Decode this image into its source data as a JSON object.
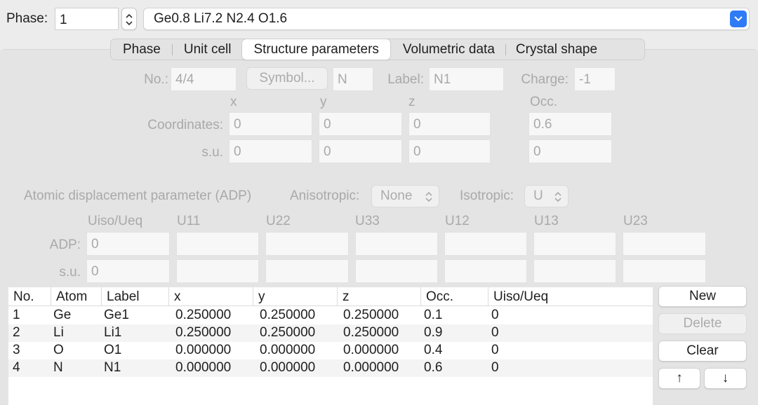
{
  "phase": {
    "label": "Phase:",
    "value": "1",
    "selected_phase": "Ge0.8 Li7.2 N2.4 O1.6"
  },
  "tabs": [
    {
      "label": "Phase",
      "selected": false
    },
    {
      "label": "Unit cell",
      "selected": false
    },
    {
      "label": "Structure parameters",
      "selected": true
    },
    {
      "label": "Volumetric data",
      "selected": false
    },
    {
      "label": "Crystal shape",
      "selected": false
    }
  ],
  "atom_form": {
    "no_label": "No.:",
    "no_value": "4/4",
    "symbol_button": "Symbol...",
    "symbol_value": "N",
    "label_label": "Label:",
    "label_value": "N1",
    "charge_label": "Charge:",
    "charge_value": "-1",
    "col_x": "x",
    "col_y": "y",
    "col_z": "z",
    "col_occ": "Occ.",
    "coordinates_label": "Coordinates:",
    "coord_x": "0",
    "coord_y": "0",
    "coord_z": "0",
    "occ_value": "0.6",
    "su_label": "s.u.",
    "su_x": "0",
    "su_y": "0",
    "su_z": "0",
    "su_occ": "0"
  },
  "adp": {
    "section_label": "Atomic displacement parameter (ADP)",
    "anisotropic_label": "Anisotropic:",
    "anisotropic_value": "None",
    "isotropic_label": "Isotropic:",
    "isotropic_value": "U",
    "columns": [
      "Uiso/Ueq",
      "U11",
      "U22",
      "U33",
      "U12",
      "U13",
      "U23"
    ],
    "adp_label": "ADP:",
    "adp_values": [
      "0",
      "",
      "",
      "",
      "",
      "",
      ""
    ],
    "su_label": "s.u.",
    "su_values": [
      "0",
      "",
      "",
      "",
      "",
      "",
      ""
    ]
  },
  "table": {
    "headers": [
      "No.",
      "Atom",
      "Label",
      "x",
      "y",
      "z",
      "Occ.",
      "Uiso/Ueq"
    ],
    "rows": [
      [
        "1",
        "Ge",
        "Ge1",
        "0.250000",
        "0.250000",
        "0.250000",
        "0.1",
        "0"
      ],
      [
        "2",
        "Li",
        "Li1",
        "0.250000",
        "0.250000",
        "0.250000",
        "0.9",
        "0"
      ],
      [
        "3",
        "O",
        "O1",
        "0.000000",
        "0.000000",
        "0.000000",
        "0.4",
        "0"
      ],
      [
        "4",
        "N",
        "N1",
        "0.000000",
        "0.000000",
        "0.000000",
        "0.6",
        "0"
      ]
    ]
  },
  "buttons": {
    "new": "New",
    "delete": "Delete",
    "clear": "Clear",
    "up": "↑",
    "down": "↓"
  },
  "colors": {
    "accent": "#2f7bf6",
    "disabled_text": "#a9a9a9"
  }
}
